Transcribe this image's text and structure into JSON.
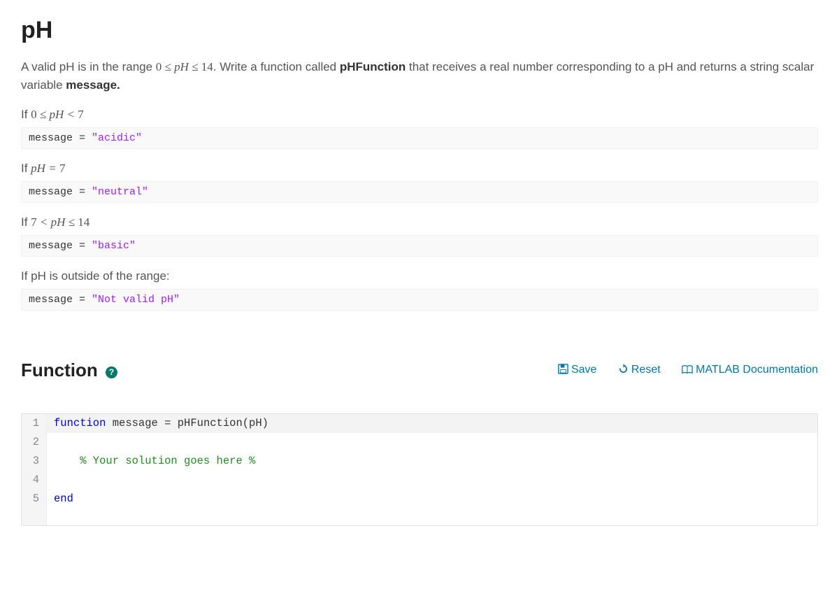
{
  "title": "pH",
  "desc_parts": {
    "prefix": "A valid pH is in the range ",
    "range_math": "0 ≤ pH ≤ 14",
    "mid1": ". Write a function called ",
    "fn_name": "pHFunction",
    "mid2": " that receives a real number corresponding to a pH and returns a string scalar variable ",
    "var_name": "message."
  },
  "conditions": [
    {
      "label_pre": "If ",
      "math": "0 ≤ pH < 7",
      "label_post": "",
      "is_math": true,
      "code_plain": "message = ",
      "code_str": "\"acidic\""
    },
    {
      "label_pre": "If ",
      "math": "pH = 7",
      "label_post": "",
      "is_math": true,
      "code_plain": "message = ",
      "code_str": "\"neutral\""
    },
    {
      "label_pre": "If ",
      "math": "7 < pH ≤ 14",
      "label_post": "",
      "is_math": true,
      "code_plain": "message = ",
      "code_str": "\"basic\""
    },
    {
      "label_pre": "If pH is outside of the range:",
      "math": "",
      "label_post": "",
      "is_math": false,
      "code_plain": "message = ",
      "code_str": "\"Not valid pH\""
    }
  ],
  "section": {
    "title": "Function",
    "help": "?"
  },
  "toolbar": {
    "save": "Save",
    "reset": "Reset",
    "doc": "MATLAB Documentation"
  },
  "editor": {
    "lines": [
      {
        "n": "1",
        "html_parts": [
          "kw:function",
          "plain: message = pHFunction(pH)"
        ],
        "highlight": true
      },
      {
        "n": "2",
        "html_parts": [],
        "highlight": false
      },
      {
        "n": "3",
        "html_parts": [
          "comment:    % Your solution goes here %"
        ],
        "highlight": false
      },
      {
        "n": "4",
        "html_parts": [],
        "highlight": false
      },
      {
        "n": "5",
        "html_parts": [
          "kw:end"
        ],
        "highlight": false
      }
    ]
  }
}
